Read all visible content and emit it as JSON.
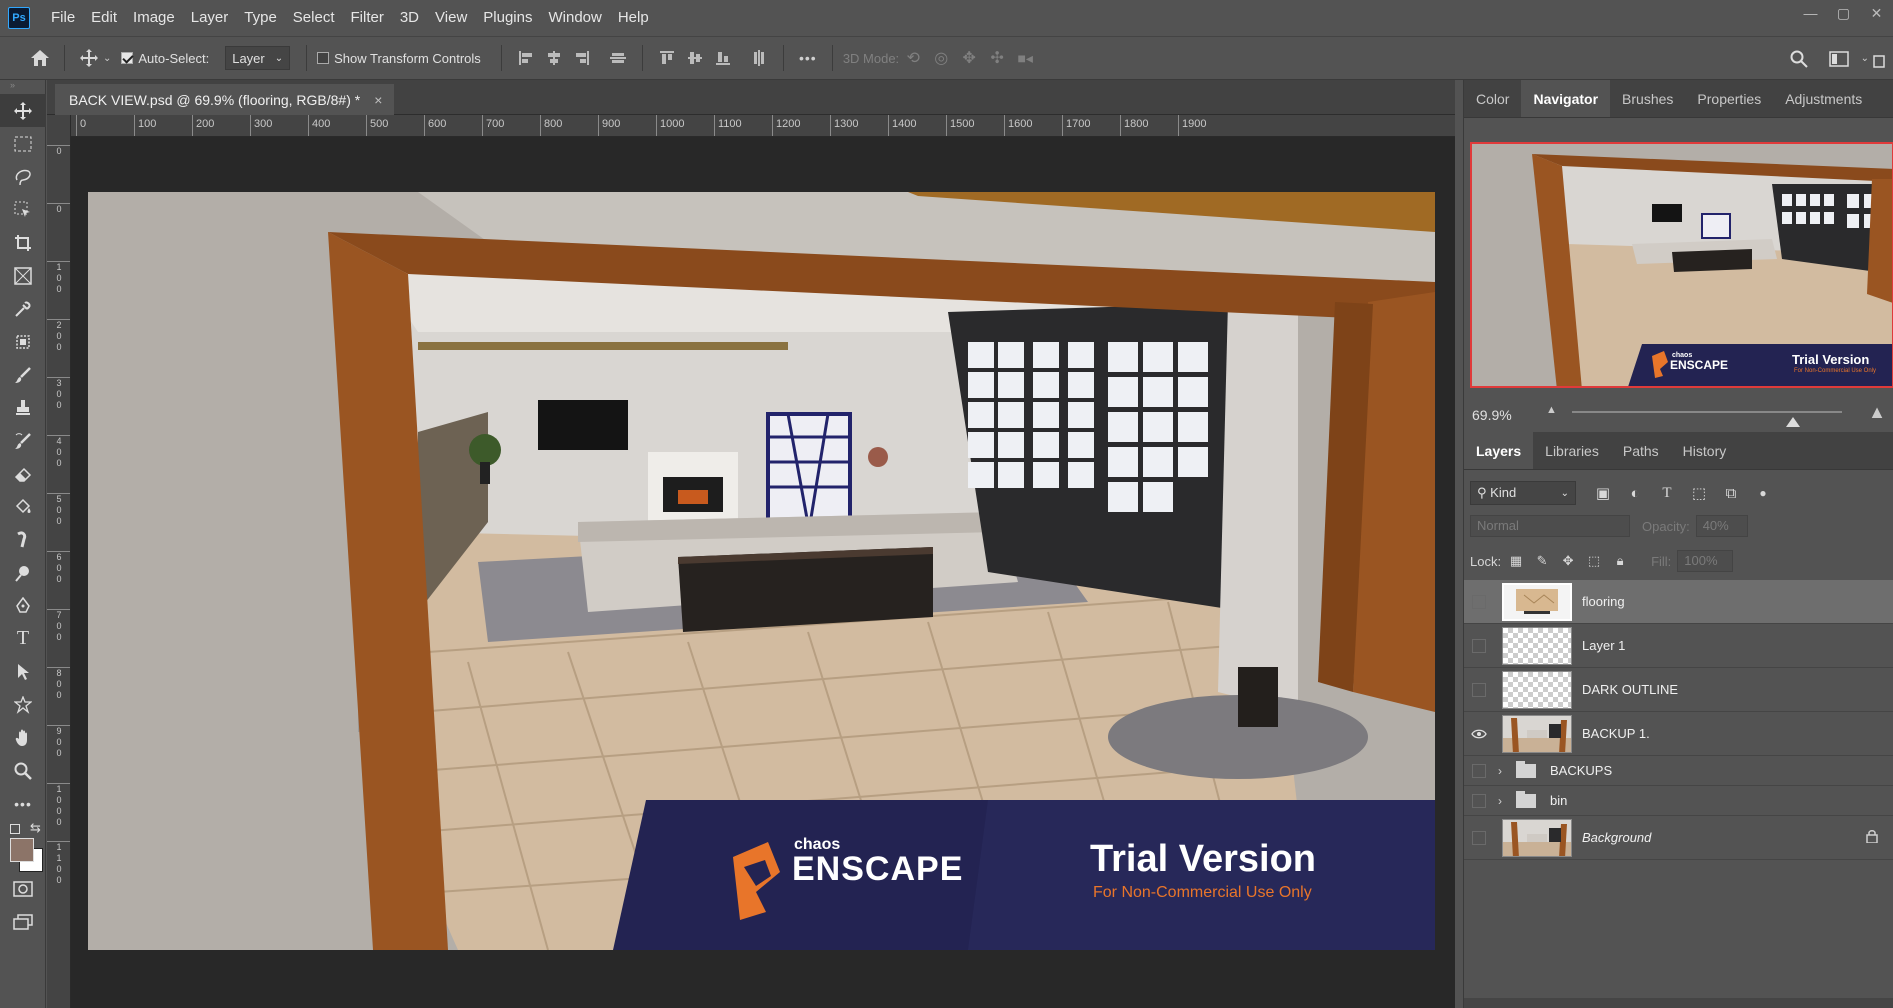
{
  "app": {
    "logo_text": "Ps",
    "menu": [
      "File",
      "Edit",
      "Image",
      "Layer",
      "Type",
      "Select",
      "Filter",
      "3D",
      "View",
      "Plugins",
      "Window",
      "Help"
    ],
    "window_controls": [
      "—",
      "▢",
      "✕"
    ]
  },
  "options_bar": {
    "auto_select_label": "Auto-Select:",
    "auto_select_checked": true,
    "auto_select_target": "Layer",
    "show_transform_label": "Show Transform Controls",
    "show_transform_checked": false,
    "more_label": "•••",
    "mode_3d_label": "3D Mode:"
  },
  "document": {
    "tab_title": "BACK VIEW.psd @ 69.9% (flooring, RGB/8#) *",
    "close_glyph": "×"
  },
  "ruler": {
    "h_labels": [
      "0",
      "100",
      "200",
      "300",
      "400",
      "500",
      "600",
      "700",
      "800",
      "900",
      "1000",
      "1100",
      "1200",
      "1300",
      "1400",
      "1500",
      "1600",
      "1700",
      "1800",
      "1900"
    ],
    "v_labels": [
      "0",
      "0",
      "100",
      "200",
      "300",
      "400",
      "500",
      "600",
      "700",
      "800",
      "900",
      "1000",
      "1100"
    ]
  },
  "canvas": {
    "watermark_brand_small": "chaos",
    "watermark_brand": "ENSCAPE",
    "watermark_title": "Trial Version",
    "watermark_sub": "For Non-Commercial Use Only",
    "accent_color": "#e8752a",
    "banner_color": "#232352"
  },
  "panels": {
    "top_tabs": [
      "Color",
      "Navigator",
      "Brushes",
      "Properties",
      "Adjustments"
    ],
    "active_top_tab": "Navigator",
    "navigator": {
      "zoom": "69.9%",
      "zoom_slider_fraction": 0.82,
      "thumb_brand_small": "chaos",
      "thumb_brand": "ENSCAPE",
      "thumb_title": "Trial Version",
      "thumb_sub": "For Non-Commercial Use Only"
    },
    "layer_tabs": [
      "Layers",
      "Libraries",
      "Paths",
      "History"
    ],
    "active_layer_tab": "Layers",
    "kind_label": "Kind",
    "blend_mode": "Normal",
    "opacity_label": "Opacity:",
    "opacity_value": "40%",
    "lock_label": "Lock:",
    "fill_label": "Fill:",
    "fill_value": "100%",
    "layers": [
      {
        "name": "flooring",
        "visible": false,
        "selected": true,
        "type": "smart"
      },
      {
        "name": "Layer 1",
        "visible": false,
        "selected": false,
        "type": "transparent"
      },
      {
        "name": "DARK OUTLINE",
        "visible": false,
        "selected": false,
        "type": "transparent"
      },
      {
        "name": "BACKUP 1.",
        "visible": true,
        "selected": false,
        "type": "image"
      },
      {
        "name": "BACKUPS",
        "visible": false,
        "selected": false,
        "type": "group"
      },
      {
        "name": "bin",
        "visible": false,
        "selected": false,
        "type": "group"
      },
      {
        "name": "Background",
        "visible": false,
        "selected": false,
        "type": "background",
        "locked": true
      }
    ]
  }
}
